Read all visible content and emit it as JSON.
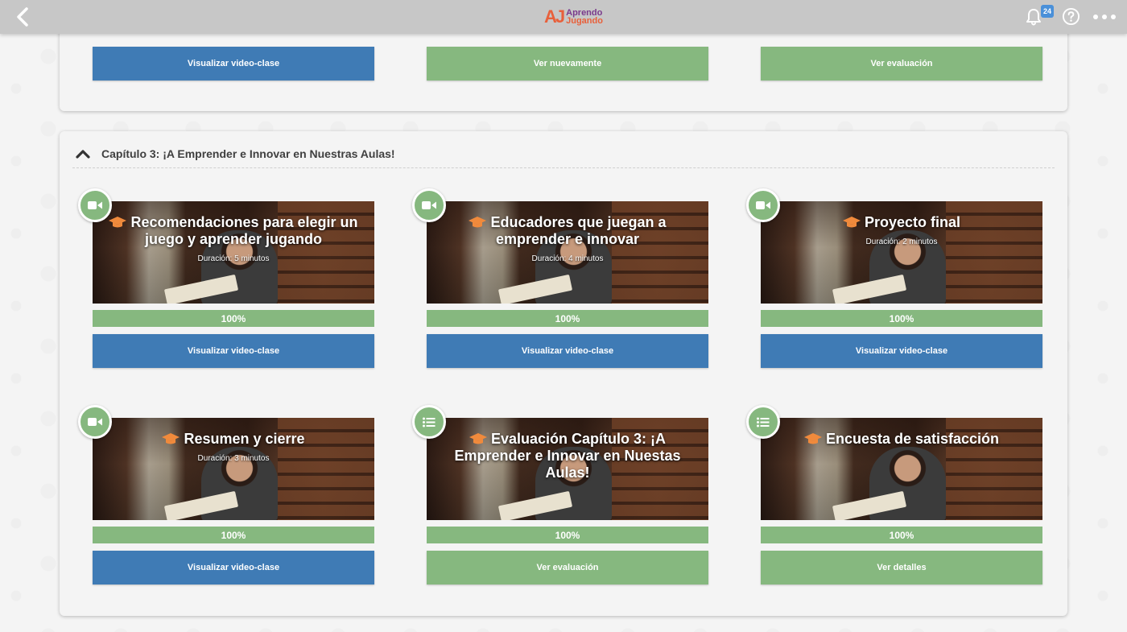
{
  "header": {
    "logo_mark": "AJ",
    "logo_line1": "Aprendo",
    "logo_line2": "Jugando",
    "notifications_count": "24",
    "icons": [
      "back-chevron-icon",
      "bell-icon",
      "help-icon",
      "more-dots-icon"
    ]
  },
  "colors": {
    "topbar": "#c7c7c7",
    "blue_button": "#3f7bb5",
    "green": "#86b87f",
    "badge": "#4a90d9",
    "brand_orange": "#e8603b",
    "brand_purple": "#7a3a8c"
  },
  "previous_chapter": {
    "actions": [
      {
        "label": "Visualizar video-clase",
        "style": "blue"
      },
      {
        "label": "Ver nuevamente",
        "style": "green"
      },
      {
        "label": "Ver evaluación",
        "style": "green"
      }
    ]
  },
  "chapter": {
    "title": "Capítulo 3: ¡A Emprender e Innovar en Nuestras Aulas!",
    "expanded": true,
    "cards": [
      {
        "type_icon": "video-icon",
        "title": "Recomendaciones para elegir un juego y aprender jugando",
        "duration": "Duración: 5 minutos",
        "progress": "100%",
        "action": "Visualizar video-clase",
        "style": "blue"
      },
      {
        "type_icon": "video-icon",
        "title": "Educadores que juegan a emprender e innovar",
        "duration": "Duración: 4 minutos",
        "progress": "100%",
        "action": "Visualizar video-clase",
        "style": "blue"
      },
      {
        "type_icon": "video-icon",
        "title": "Proyecto final",
        "duration": "Duración: 2 minutos",
        "progress": "100%",
        "action": "Visualizar video-clase",
        "style": "blue"
      },
      {
        "type_icon": "video-icon",
        "title": "Resumen y cierre",
        "duration": "Duración: 3 minutos",
        "progress": "100%",
        "action": "Visualizar video-clase",
        "style": "blue"
      },
      {
        "type_icon": "list-icon",
        "title": "Evaluación Capítulo 3: ¡A Emprender e Innovar en Nuestas Aulas!",
        "duration": "",
        "progress": "100%",
        "action": "Ver evaluación",
        "style": "green"
      },
      {
        "type_icon": "list-icon",
        "title": "Encuesta de satisfacción",
        "duration": "",
        "progress": "100%",
        "action": "Ver detalles",
        "style": "green"
      }
    ]
  }
}
